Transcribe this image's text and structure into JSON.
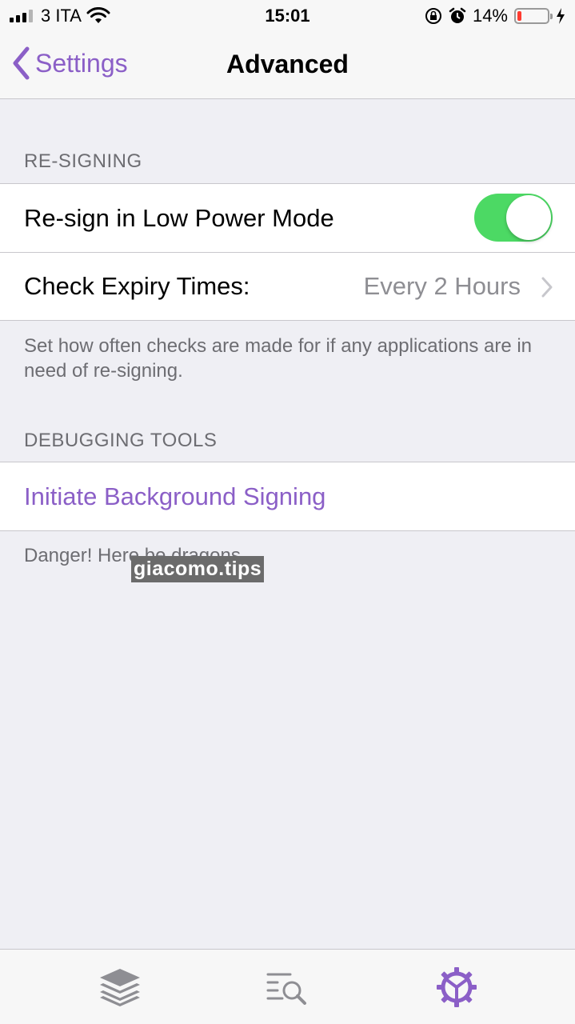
{
  "status_bar": {
    "carrier": "3 ITA",
    "time": "15:01",
    "battery_percent": "14%",
    "signal_bars_filled": 3,
    "signal_bars_total": 4,
    "battery_level": 0.14
  },
  "nav": {
    "back_label": "Settings",
    "title": "Advanced"
  },
  "sections": {
    "resigning": {
      "header": "RE-SIGNING",
      "low_power_label": "Re-sign in Low Power Mode",
      "low_power_on": true,
      "expiry_label": "Check Expiry Times:",
      "expiry_value": "Every 2 Hours",
      "footer": "Set how often checks are made for if any applications are in need of re-signing."
    },
    "debugging": {
      "header": "DEBUGGING TOOLS",
      "initiate_label": "Initiate Background Signing",
      "footer": "Danger! Here be dragons..."
    }
  },
  "watermark": "giacomo.tips",
  "tabs": [
    {
      "icon": "stack-icon",
      "active": false
    },
    {
      "icon": "search-list-icon",
      "active": false
    },
    {
      "icon": "gear-icon",
      "active": true
    }
  ],
  "colors": {
    "accent": "#8b5fc7",
    "toggle_on": "#4cd964",
    "background": "#efeff4",
    "inactive_tab": "#8e8e93",
    "battery_low": "#ff3b30"
  }
}
